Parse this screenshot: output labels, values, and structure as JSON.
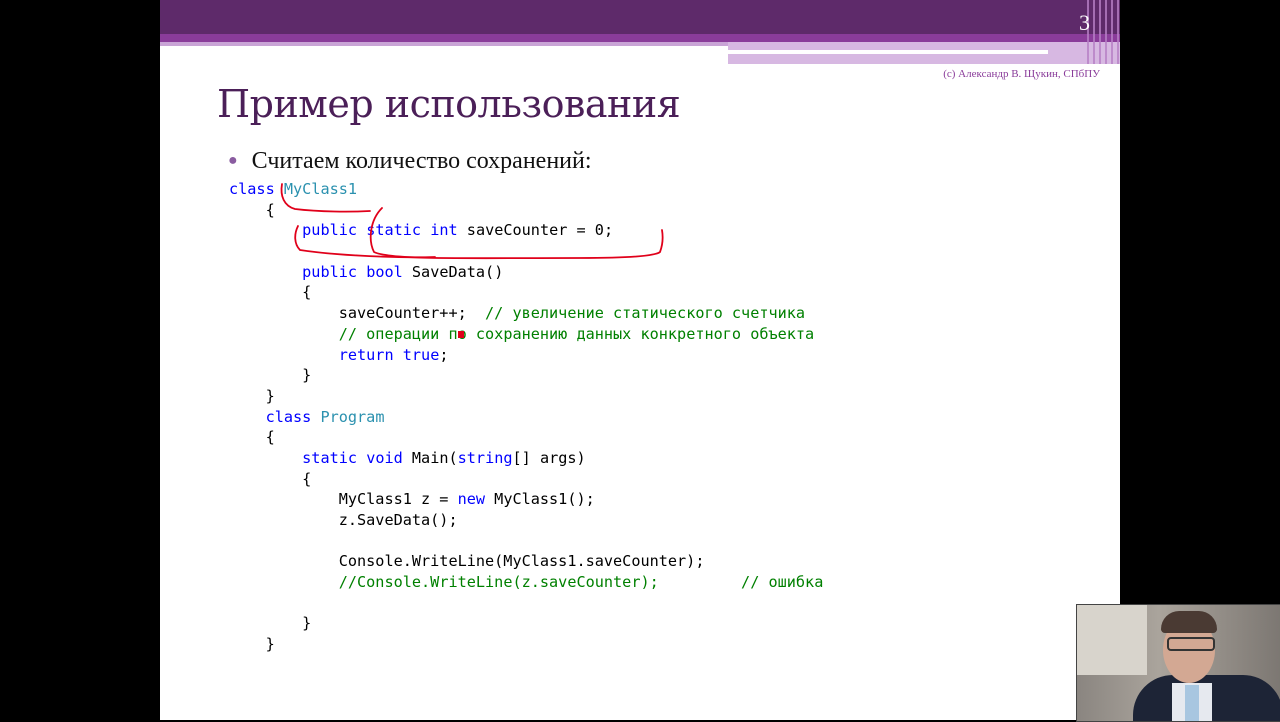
{
  "slide": {
    "page_number": "3",
    "copyright": "(c) Александр В. Щукин, СПбПУ",
    "title": "Пример использования",
    "bullet": "Считаем количество сохранений:"
  },
  "code_lines": [
    [
      {
        "t": "class ",
        "c": "kw"
      },
      {
        "t": "MyClass1",
        "c": "ty"
      }
    ],
    [
      {
        "t": "    {",
        "c": ""
      }
    ],
    [
      {
        "t": "        ",
        "c": ""
      },
      {
        "t": "public",
        "c": "kw"
      },
      {
        "t": " ",
        "c": ""
      },
      {
        "t": "static",
        "c": "kw"
      },
      {
        "t": " ",
        "c": ""
      },
      {
        "t": "int",
        "c": "kw"
      },
      {
        "t": " saveCounter = 0;",
        "c": ""
      }
    ],
    [
      {
        "t": "",
        "c": ""
      }
    ],
    [
      {
        "t": "        ",
        "c": ""
      },
      {
        "t": "public",
        "c": "kw"
      },
      {
        "t": " ",
        "c": ""
      },
      {
        "t": "bool",
        "c": "kw"
      },
      {
        "t": " SaveData()",
        "c": ""
      }
    ],
    [
      {
        "t": "        {",
        "c": ""
      }
    ],
    [
      {
        "t": "            saveCounter++;  ",
        "c": ""
      },
      {
        "t": "// увеличение статического счетчика",
        "c": "cm"
      }
    ],
    [
      {
        "t": "            ",
        "c": ""
      },
      {
        "t": "// операции по сохранению данных конкретного объекта",
        "c": "cm"
      }
    ],
    [
      {
        "t": "            ",
        "c": ""
      },
      {
        "t": "return",
        "c": "kw"
      },
      {
        "t": " ",
        "c": ""
      },
      {
        "t": "true",
        "c": "kw"
      },
      {
        "t": ";",
        "c": ""
      }
    ],
    [
      {
        "t": "        }",
        "c": ""
      }
    ],
    [
      {
        "t": "    }",
        "c": ""
      }
    ],
    [
      {
        "t": "    ",
        "c": ""
      },
      {
        "t": "class",
        "c": "kw"
      },
      {
        "t": " ",
        "c": ""
      },
      {
        "t": "Program",
        "c": "ty"
      }
    ],
    [
      {
        "t": "    {",
        "c": ""
      }
    ],
    [
      {
        "t": "        ",
        "c": ""
      },
      {
        "t": "static",
        "c": "kw"
      },
      {
        "t": " ",
        "c": ""
      },
      {
        "t": "void",
        "c": "kw"
      },
      {
        "t": " Main(",
        "c": ""
      },
      {
        "t": "string",
        "c": "kw"
      },
      {
        "t": "[] args)",
        "c": ""
      }
    ],
    [
      {
        "t": "        {",
        "c": ""
      }
    ],
    [
      {
        "t": "            MyClass1 z = ",
        "c": ""
      },
      {
        "t": "new",
        "c": "kw"
      },
      {
        "t": " MyClass1();",
        "c": ""
      }
    ],
    [
      {
        "t": "            z.SaveData();",
        "c": ""
      }
    ],
    [
      {
        "t": "",
        "c": ""
      }
    ],
    [
      {
        "t": "            Console.WriteLine(MyClass1.saveCounter);",
        "c": ""
      }
    ],
    [
      {
        "t": "            ",
        "c": ""
      },
      {
        "t": "//Console.WriteLine(z.saveCounter);         // ошибка",
        "c": "cm"
      }
    ],
    [
      {
        "t": "",
        "c": ""
      }
    ],
    [
      {
        "t": "        }",
        "c": ""
      }
    ],
    [
      {
        "t": "    }",
        "c": ""
      }
    ]
  ],
  "colors": {
    "header_dark": "#5e2a6a",
    "title_color": "#4b1f58",
    "keyword": "#0000ff",
    "type": "#2b91af",
    "comment": "#008000",
    "annotation_ink": "#e0001a"
  }
}
